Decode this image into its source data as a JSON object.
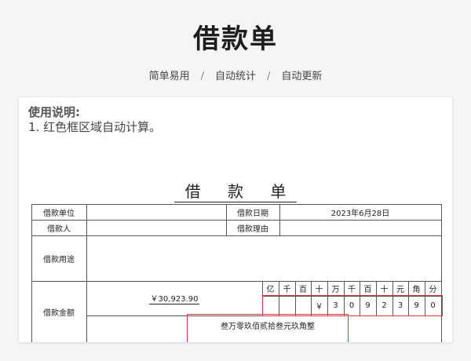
{
  "header": {
    "title": "借款单",
    "tags": [
      "简单易用",
      "自动统计",
      "自动更新"
    ],
    "separator": "/"
  },
  "instructions": {
    "heading": "使用说明:",
    "items": [
      "1. 红色框区域自动计算。"
    ]
  },
  "form": {
    "title": "借 款 单",
    "labels": {
      "borrower_unit": "借款单位",
      "loan_date": "借款日期",
      "borrower": "借款人",
      "loan_reason": "借款理由",
      "loan_purpose": "借款用途",
      "loan_amount": "借款金额"
    },
    "values": {
      "borrower_unit": "",
      "loan_date": "2023年6月28日",
      "borrower": "",
      "loan_reason": "",
      "loan_purpose": "",
      "amount": "￥30,923.90",
      "amount_in_words": "叁万零玖佰贰拾叁元玖角整"
    },
    "digit_headers": [
      "亿",
      "千",
      "百",
      "十",
      "万",
      "千",
      "百",
      "十",
      "元",
      "角",
      "分"
    ],
    "digits": [
      "",
      "",
      "",
      "￥",
      "3",
      "0",
      "9",
      "2",
      "3",
      "9",
      "0"
    ]
  },
  "colors": {
    "highlight_border": "#d9363e"
  }
}
